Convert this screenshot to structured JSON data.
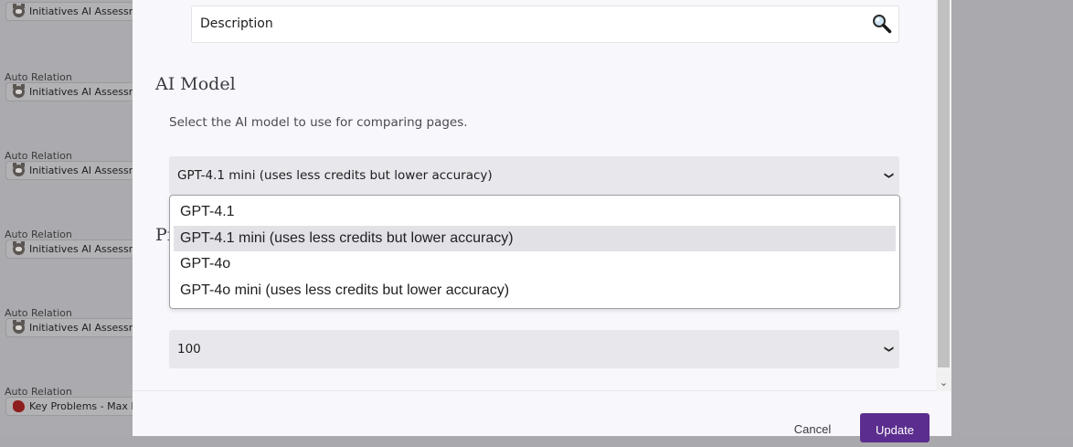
{
  "background": {
    "items": [
      {
        "label": "Auto Relation",
        "chip": "Initiatives AI Assessment",
        "icon": "cat-face-icon"
      },
      {
        "label": "Auto Relation",
        "chip": "Initiatives AI Assessment",
        "icon": "cat-face-icon"
      },
      {
        "label": "Auto Relation",
        "chip": "Initiatives AI Assessment",
        "icon": "cat-face-icon"
      },
      {
        "label": "Auto Relation",
        "chip": "Initiatives AI Assessment",
        "icon": "cat-face-icon"
      },
      {
        "label": "Auto Relation",
        "chip": "Initiatives AI Assessment",
        "icon": "cat-face-icon"
      },
      {
        "label": "Auto Relation",
        "chip": "Key Problems - Max Ir",
        "icon": "red-blob-icon"
      }
    ]
  },
  "description_field": {
    "value": "Description",
    "icon": "magnifier-icon"
  },
  "ai_model": {
    "title": "AI Model",
    "hint": "Select the AI model to use for comparing pages.",
    "selected": "GPT-4.1 mini (uses less credits but lower accuracy)",
    "options": [
      "GPT-4.1",
      "GPT-4.1 mini (uses less credits but lower accuracy)",
      "GPT-4o",
      "GPT-4o mini (uses less credits but lower accuracy)"
    ]
  },
  "obscured_section": {
    "title_fragment": "Pr"
  },
  "count_select": {
    "value": "100"
  },
  "footer": {
    "cancel_label": "Cancel",
    "update_label": "Update"
  },
  "colors": {
    "accent": "#5b2d8e"
  }
}
